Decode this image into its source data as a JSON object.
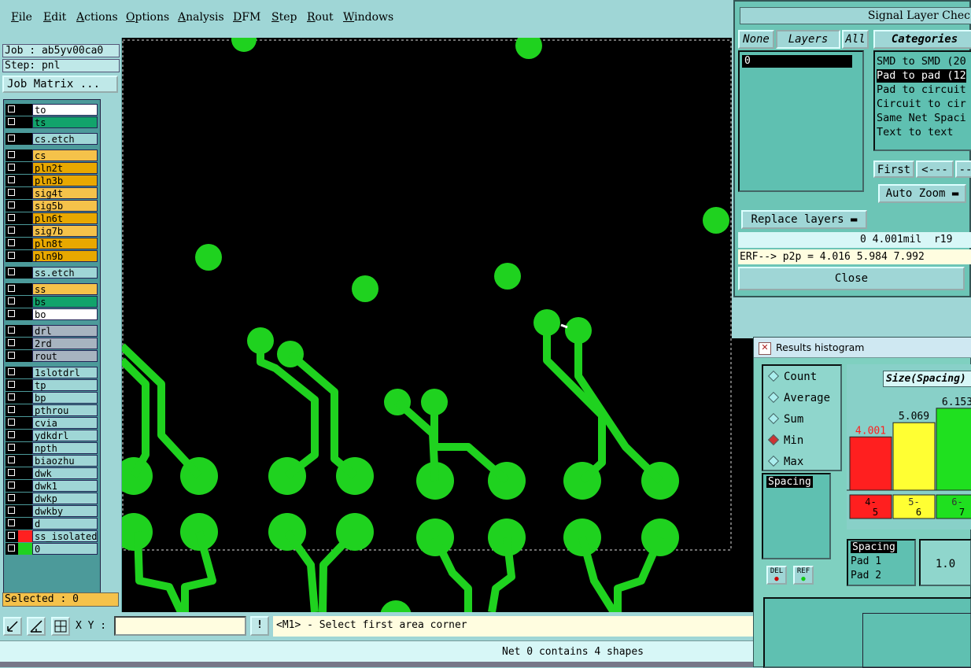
{
  "menu": [
    "File",
    "Edit",
    "Actions",
    "Options",
    "Analysis",
    "DFM",
    "Step",
    "Rout",
    "Windows"
  ],
  "job": {
    "job_label": "Job : ab5yv00ca0",
    "step_label": "Step: pnl",
    "matrix_button": "Job Matrix ..."
  },
  "layers": [
    {
      "name": "to",
      "color": "#ffffff"
    },
    {
      "name": "ts",
      "color": "#12a36b"
    },
    {
      "name": "cs.etch",
      "color": "#9fd6d6"
    },
    {
      "name": "cs",
      "color": "#f5c24a"
    },
    {
      "name": "pln2t",
      "color": "#e8a800"
    },
    {
      "name": "pln3b",
      "color": "#e8a800"
    },
    {
      "name": "sig4t",
      "color": "#f5c24a"
    },
    {
      "name": "sig5b",
      "color": "#f5c24a"
    },
    {
      "name": "pln6t",
      "color": "#e8a800"
    },
    {
      "name": "sig7b",
      "color": "#f5c24a"
    },
    {
      "name": "pln8t",
      "color": "#e8a800"
    },
    {
      "name": "pln9b",
      "color": "#e8a800"
    },
    {
      "name": "ss.etch",
      "color": "#9fd6d6"
    },
    {
      "name": "ss",
      "color": "#f5c24a"
    },
    {
      "name": "bs",
      "color": "#12a36b"
    },
    {
      "name": "bo",
      "color": "#ffffff"
    },
    {
      "name": "drl",
      "color": "#a7b4c0"
    },
    {
      "name": "2rd",
      "color": "#a7b4c0"
    },
    {
      "name": "rout",
      "color": "#a7b4c0"
    },
    {
      "name": "1slotdrl",
      "color": "#9fd6d6"
    },
    {
      "name": "tp",
      "color": "#9fd6d6"
    },
    {
      "name": "bp",
      "color": "#9fd6d6"
    },
    {
      "name": "pthrou",
      "color": "#9fd6d6"
    },
    {
      "name": "cvia",
      "color": "#9fd6d6"
    },
    {
      "name": "ydkdrl",
      "color": "#9fd6d6"
    },
    {
      "name": "npth",
      "color": "#9fd6d6"
    },
    {
      "name": "biaozhu",
      "color": "#9fd6d6"
    },
    {
      "name": "dwk",
      "color": "#9fd6d6"
    },
    {
      "name": "dwk1",
      "color": "#9fd6d6"
    },
    {
      "name": "dwkp",
      "color": "#9fd6d6"
    },
    {
      "name": "dwkby",
      "color": "#9fd6d6"
    },
    {
      "name": "d",
      "color": "#9fd6d6"
    },
    {
      "name": "ss_isolated",
      "color": "#9fd6d6",
      "swatch": "#ff2020"
    },
    {
      "name": "0",
      "color": "#9fd6d6",
      "swatch": "#20d020"
    }
  ],
  "selected_label": "Selected : 0",
  "cmd": {
    "xy_label": "X Y :",
    "xy_value": "",
    "bang": "!",
    "prompt": "<M1> - Select first area corner"
  },
  "status": "Net 0 contains 4 shapes",
  "slc": {
    "title": "Signal Layer Chec",
    "none_btn": "None",
    "layers_btn": "Layers",
    "all_btn": "All",
    "categories_label": "Categories",
    "layer_item": "0",
    "categories": [
      "SMD to SMD (20",
      "Pad to pad (12",
      "Pad to circuit",
      "Circuit to cir",
      "Same Net Spaci",
      "Text to text"
    ],
    "selected_category": 1,
    "first_btn": "First",
    "prev_btn": "<---",
    "next_btn": "--",
    "autozoom_btn": "Auto Zoom",
    "replace_btn": "Replace layers",
    "readout": "0 4.001mil  r19",
    "erf": "ERF--> p2p = 4.016 5.984 7.992",
    "close_btn": "Close"
  },
  "hist": {
    "title": "Results histogram",
    "radios": [
      "Count",
      "Average",
      "Sum",
      "Min",
      "Max"
    ],
    "radio_selected": 3,
    "list_item": "Spacing",
    "chart_title": "Size(Spacing)",
    "del_label": "DEL",
    "ref_label": "REF",
    "bottom_items": [
      "Spacing",
      "Pad 1",
      "Pad 2"
    ],
    "value": "1.0"
  },
  "chart_data": {
    "type": "bar",
    "title": "Size(Spacing)",
    "categories": [
      "4-5",
      "5-6",
      "6-7"
    ],
    "values": [
      4.001,
      5.069,
      6.153
    ],
    "value_labels": [
      "4.001",
      "5.069",
      "6.153"
    ],
    "colors": [
      "#ff1f1f",
      "#ffff33",
      "#1fe01f"
    ],
    "label_colors": [
      "#ff1f1f",
      "#000000",
      "#000000"
    ]
  }
}
